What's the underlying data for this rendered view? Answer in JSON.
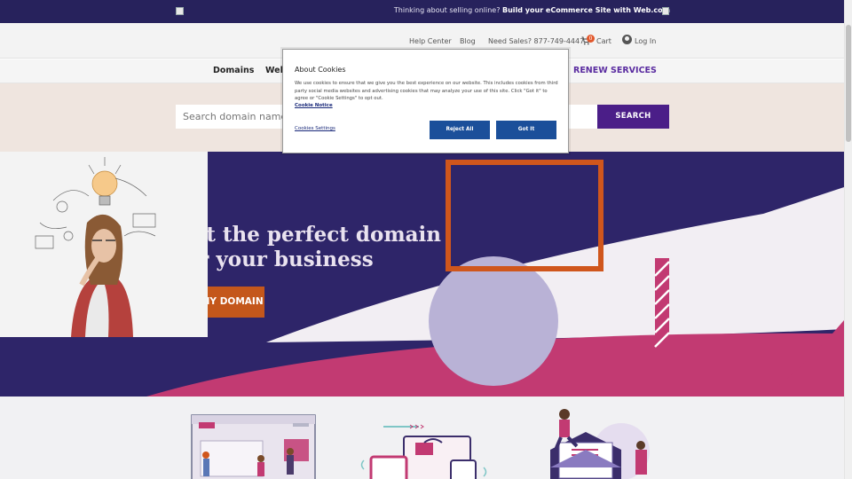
{
  "promo": {
    "message_prefix": "Thinking about selling online?",
    "message_bold": "Build your eCommerce Site with Web.com"
  },
  "utility": {
    "help_center": "Help Center",
    "blog": "Blog",
    "need_sales": "Need Sales? 877-749-4447",
    "cart_count": "0",
    "cart_label": "Cart",
    "login": "Log In"
  },
  "nav": {
    "domains": "Domains",
    "web": "Web",
    "renew": "RENEW SERVICES"
  },
  "search": {
    "placeholder": "Search domain names...",
    "button": "SEARCH"
  },
  "hero": {
    "title": "Get the perfect domain for your business",
    "cta": "GET MY DOMAIN"
  },
  "cookie": {
    "title": "About Cookies",
    "body": "We use cookies to ensure that we give you the best experience on our website. This includes cookies from third party social media websites and advertising cookies that may analyze your use of this site. Click \"Got it\" to agree or \"Cookie Settings\" to opt out.",
    "notice_link": "Cookie Notice",
    "settings_link": "Cookies Settings",
    "reject": "Reject All",
    "accept": "Got It"
  },
  "colors": {
    "brand_dark": "#27225c",
    "hero_bg": "#2e2569",
    "purple": "#4b1e88",
    "orange": "#c4571b",
    "pink": "#c23a72",
    "cookie_blue": "#1b4f9a"
  }
}
